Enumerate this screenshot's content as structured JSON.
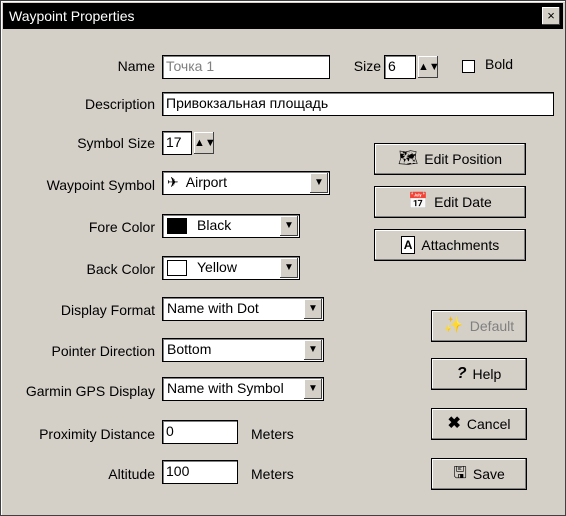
{
  "window": {
    "title": "Waypoint Properties",
    "close_glyph": "×"
  },
  "labels": {
    "name": "Name",
    "size": "Size",
    "bold": "Bold",
    "description": "Description",
    "symbol_size": "Symbol Size",
    "waypoint_symbol": "Waypoint Symbol",
    "fore_color": "Fore Color",
    "back_color": "Back Color",
    "display_format": "Display Format",
    "pointer_direction": "Pointer Direction",
    "garmin_gps_display": "Garmin GPS Display",
    "proximity_distance": "Proximity Distance",
    "altitude": "Altitude",
    "meters_1": "Meters",
    "meters_2": "Meters"
  },
  "fields": {
    "name": "Точка 1",
    "size": "6",
    "bold_checked": false,
    "description": "Привокзальная площадь",
    "symbol_size": "17",
    "waypoint_symbol": "Airport",
    "fore_color": "Black",
    "fore_color_hex": "#000000",
    "back_color": "Yellow",
    "back_color_hex": "#ffffff",
    "display_format": "Name with Dot",
    "pointer_direction": "Bottom",
    "garmin_gps_display": "Name with Symbol",
    "proximity_distance": "0",
    "altitude": "100"
  },
  "buttons": {
    "edit_position": "Edit Position",
    "edit_date": "Edit Date",
    "attachments": "Attachments",
    "default": "Default",
    "help": "Help",
    "cancel": "Cancel",
    "save": "Save"
  },
  "icons": {
    "airport": "airplane-icon",
    "edit_position": "map-pencil-icon",
    "edit_date": "calendar-icon",
    "attachments": "document-a-icon",
    "default": "wand-icon",
    "help": "question-icon",
    "cancel": "x-icon",
    "save": "save-icon"
  }
}
